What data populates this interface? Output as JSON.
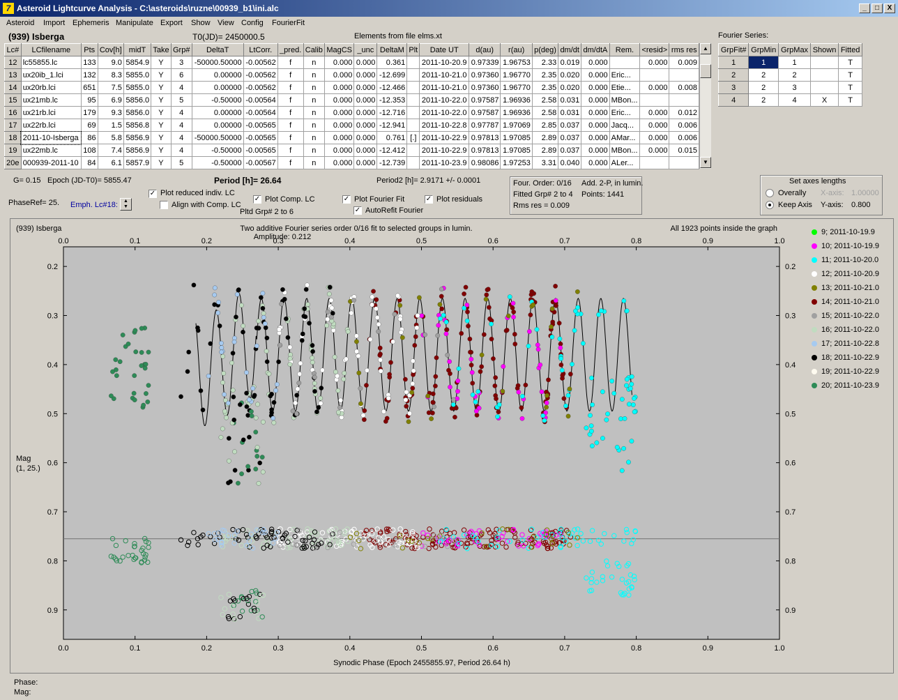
{
  "window": {
    "title": "Asteroid Lightcurve Analysis - C:\\asteroids\\ruzne\\00939_b1\\ini.alc",
    "min": "_",
    "max": "□",
    "close": "X"
  },
  "menu": [
    "Asteroid",
    "Import",
    "Ephemeris",
    "Manipulate",
    "Export",
    "Show",
    "View",
    "Config",
    "FourierFit"
  ],
  "header": {
    "asteroid": "(939) Isberga",
    "t0": "T0(JD)= 2450000.5",
    "elements": "Elements from file elms.xt",
    "fourier_title": "Fourier Series:"
  },
  "lc_table": {
    "columns": [
      "Lc#",
      "LCfilename",
      "Pts",
      "Cov[h]",
      "midT",
      "Take",
      "Grp#",
      "DeltaT",
      "LtCorr.",
      "_pred.",
      "Calib",
      "MagCS",
      "_unc",
      "DeltaM",
      "Plt",
      "Date UT",
      "d(au)",
      "r(au)",
      "p(deg)",
      "dm/dt",
      "dm/dtA",
      "Rem.",
      "<resid>",
      "rms res"
    ],
    "rows": [
      [
        "12",
        "lc55855.lc",
        "133",
        "9.0",
        "5854.9",
        "Y",
        "3",
        "-50000.50000",
        "-0.00562",
        "f",
        "n",
        "0.000",
        "0.000",
        "0.361",
        "",
        "2011-10-20.9",
        "0.97339",
        "1.96753",
        "2.33",
        "0.019",
        "0.000",
        "",
        "0.000",
        "0.009"
      ],
      [
        "13",
        "ux20ib_1.lci",
        "132",
        "8.3",
        "5855.0",
        "Y",
        "6",
        "0.00000",
        "-0.00562",
        "f",
        "n",
        "0.000",
        "0.000",
        "-12.699",
        "",
        "2011-10-21.0",
        "0.97360",
        "1.96770",
        "2.35",
        "0.020",
        "0.000",
        "Eric...",
        "",
        ""
      ],
      [
        "14",
        "ux20rb.lci",
        "651",
        "7.5",
        "5855.0",
        "Y",
        "4",
        "0.00000",
        "-0.00562",
        "f",
        "n",
        "0.000",
        "0.000",
        "-12.466",
        "",
        "2011-10-21.0",
        "0.97360",
        "1.96770",
        "2.35",
        "0.020",
        "0.000",
        "Etie...",
        "0.000",
        "0.008"
      ],
      [
        "15",
        "ux21mb.lc",
        "95",
        "6.9",
        "5856.0",
        "Y",
        "5",
        "-0.50000",
        "-0.00564",
        "f",
        "n",
        "0.000",
        "0.000",
        "-12.353",
        "",
        "2011-10-22.0",
        "0.97587",
        "1.96936",
        "2.58",
        "0.031",
        "0.000",
        "MBon...",
        "",
        ""
      ],
      [
        "16",
        "ux21rb.lci",
        "179",
        "9.3",
        "5856.0",
        "Y",
        "4",
        "0.00000",
        "-0.00564",
        "f",
        "n",
        "0.000",
        "0.000",
        "-12.716",
        "",
        "2011-10-22.0",
        "0.97587",
        "1.96936",
        "2.58",
        "0.031",
        "0.000",
        "Eric...",
        "0.000",
        "0.012"
      ],
      [
        "17",
        "ux22rb.lci",
        "69",
        "1.5",
        "5856.8",
        "Y",
        "4",
        "0.00000",
        "-0.00565",
        "f",
        "n",
        "0.000",
        "0.000",
        "-12.941",
        "",
        "2011-10-22.8",
        "0.97787",
        "1.97069",
        "2.85",
        "0.037",
        "0.000",
        "Jacq...",
        "0.000",
        "0.006"
      ],
      [
        "18",
        "2011-10-Isberga",
        "86",
        "5.8",
        "5856.9",
        "Y",
        "4",
        "-50000.50000",
        "-0.00565",
        "f",
        "n",
        "0.000",
        "0.000",
        "0.761",
        "[.]",
        "2011-10-22.9",
        "0.97813",
        "1.97085",
        "2.89",
        "0.037",
        "0.000",
        "AMar...",
        "0.000",
        "0.006"
      ],
      [
        "19",
        "ux22mb.lc",
        "108",
        "7.4",
        "5856.9",
        "Y",
        "4",
        "-0.50000",
        "-0.00565",
        "f",
        "n",
        "0.000",
        "0.000",
        "-12.412",
        "",
        "2011-10-22.9",
        "0.97813",
        "1.97085",
        "2.89",
        "0.037",
        "0.000",
        "MBon...",
        "0.000",
        "0.015"
      ],
      [
        "20e",
        "000939-2011-10",
        "84",
        "6.1",
        "5857.9",
        "Y",
        "5",
        "-0.50000",
        "-0.00567",
        "f",
        "n",
        "0.000",
        "0.000",
        "-12.739",
        "",
        "2011-10-23.9",
        "0.98086",
        "1.97253",
        "3.31",
        "0.040",
        "0.000",
        "ALer...",
        "",
        ""
      ]
    ]
  },
  "fourier_table": {
    "columns": [
      "GrpFit#",
      "GrpMin",
      "GrpMax",
      "Shown",
      "Fitted"
    ],
    "rows": [
      [
        "1",
        "1",
        "1",
        "",
        "T"
      ],
      [
        "2",
        "2",
        "2",
        "",
        "T"
      ],
      [
        "3",
        "2",
        "3",
        "",
        "T"
      ],
      [
        "4",
        "2",
        "4",
        "X",
        "T"
      ]
    ]
  },
  "controls": {
    "g": "G= 0.15",
    "epoch": "Epoch (JD-T0)= 5855.47",
    "period": "Period [h]= 26.64",
    "period2": "Period2 [h]= 2.9171 +/- 0.0001",
    "phaseref": "PhaseRef= 25.",
    "emph": "Emph. Lc#18:",
    "cb_reduced": "Plot reduced indiv. LC",
    "cb_align": "Align with Comp. LC",
    "cb_comp": "Plot Comp. LC",
    "pltd_grp": "Pltd Grp#  2  to   6",
    "cb_fourier": "Plot Fourier Fit",
    "cb_residuals": "Plot residuals",
    "cb_autorefit": "AutoRefit Fourier",
    "info_order": "Four. Order:  0/16",
    "info_add": "Add. 2-P, in lumin.",
    "info_fitted": "Fitted Grp# 2 to 4",
    "info_points": "Points: 1441",
    "info_rms": "Rms res     = 0.009",
    "axes_title": "Set axes lengths",
    "radio_overall": "Overally",
    "radio_keep": "Keep Axis",
    "x_axis_label": "X-axis:",
    "x_axis_val": "1.00000",
    "y_axis_label": "Y-axis:",
    "y_axis_val": "0.800"
  },
  "chart_data": {
    "type": "scatter",
    "title_left": "(939) Isberga",
    "title_center": "Two additive Fourier series order 0/16 fit to selected groups in lumin.",
    "amplitude": "Amplitude: 0.212",
    "title_right": "All 1923 points inside the graph",
    "ylabel": "Mag",
    "ylabel2": "(1, 25.)",
    "xlabel": "Synodic Phase (Epoch 2455855.97, Period 26.64 h)",
    "xlim": [
      0.0,
      1.0
    ],
    "ylim": [
      0.16,
      0.96
    ],
    "y_inverted": true,
    "x_ticks": [
      "0.0",
      "0.1",
      "0.2",
      "0.3",
      "0.4",
      "0.5",
      "0.6",
      "0.7",
      "0.8",
      "0.9",
      "1.0"
    ],
    "y_ticks": [
      "0.2",
      "0.3",
      "0.4",
      "0.5",
      "0.6",
      "0.7",
      "0.8",
      "0.9"
    ],
    "residual_baseline": 0.755,
    "series": [
      {
        "name": "9; 2011-10-19.9",
        "color": "#00ff00"
      },
      {
        "name": "10; 2011-10-19.9",
        "color": "#ff00ff"
      },
      {
        "name": "11; 2011-10-20.0",
        "color": "#00ffff"
      },
      {
        "name": "12; 2011-10-20.9",
        "color": "#ffffff"
      },
      {
        "name": "13; 2011-10-21.0",
        "color": "#808000"
      },
      {
        "name": "14; 2011-10-21.0",
        "color": "#800000"
      },
      {
        "name": "15; 2011-10-22.0",
        "color": "#a0a0a0"
      },
      {
        "name": "16; 2011-10-22.0",
        "color": "#c0dcc0"
      },
      {
        "name": "17; 2011-10-22.8",
        "color": "#a6caf0"
      },
      {
        "name": "18; 2011-10-22.9",
        "color": "#000000"
      },
      {
        "name": "19; 2011-10-22.9",
        "color": "#fffbf0"
      },
      {
        "name": "20; 2011-10-23.9",
        "color": "#2e8b57"
      }
    ]
  },
  "status": {
    "phase": "Phase:",
    "mag": "Mag:"
  }
}
